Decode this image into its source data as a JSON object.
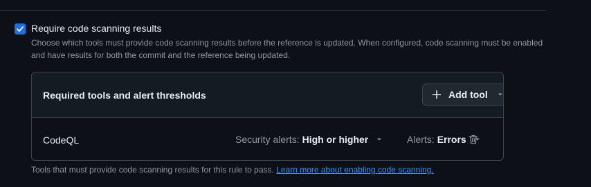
{
  "option": {
    "checked": true,
    "title": "Require code scanning results",
    "description": "Choose which tools must provide code scanning results before the reference is updated. When configured, code scanning must be enabled and have results for both the commit and the reference being updated."
  },
  "tools_box": {
    "title": "Required tools and alert thresholds",
    "add_tool_label": "Add tool",
    "rows": [
      {
        "tool": "CodeQL",
        "security_alerts_prefix": "Security alerts:",
        "security_alerts_value": "High or higher",
        "alerts_prefix": "Alerts:",
        "alerts_value": "Errors"
      }
    ]
  },
  "footer": {
    "note": "Tools that must provide code scanning results for this rule to pass.",
    "link_text": "Learn more about enabling code scanning."
  },
  "colors": {
    "background": "#0d1117",
    "accent": "#1f6feb",
    "link": "#4493f8",
    "muted_text": "#9198a1",
    "border": "#3d444d"
  },
  "icons": [
    "check-icon",
    "plus-icon",
    "chevron-down-icon",
    "trash-icon"
  ]
}
